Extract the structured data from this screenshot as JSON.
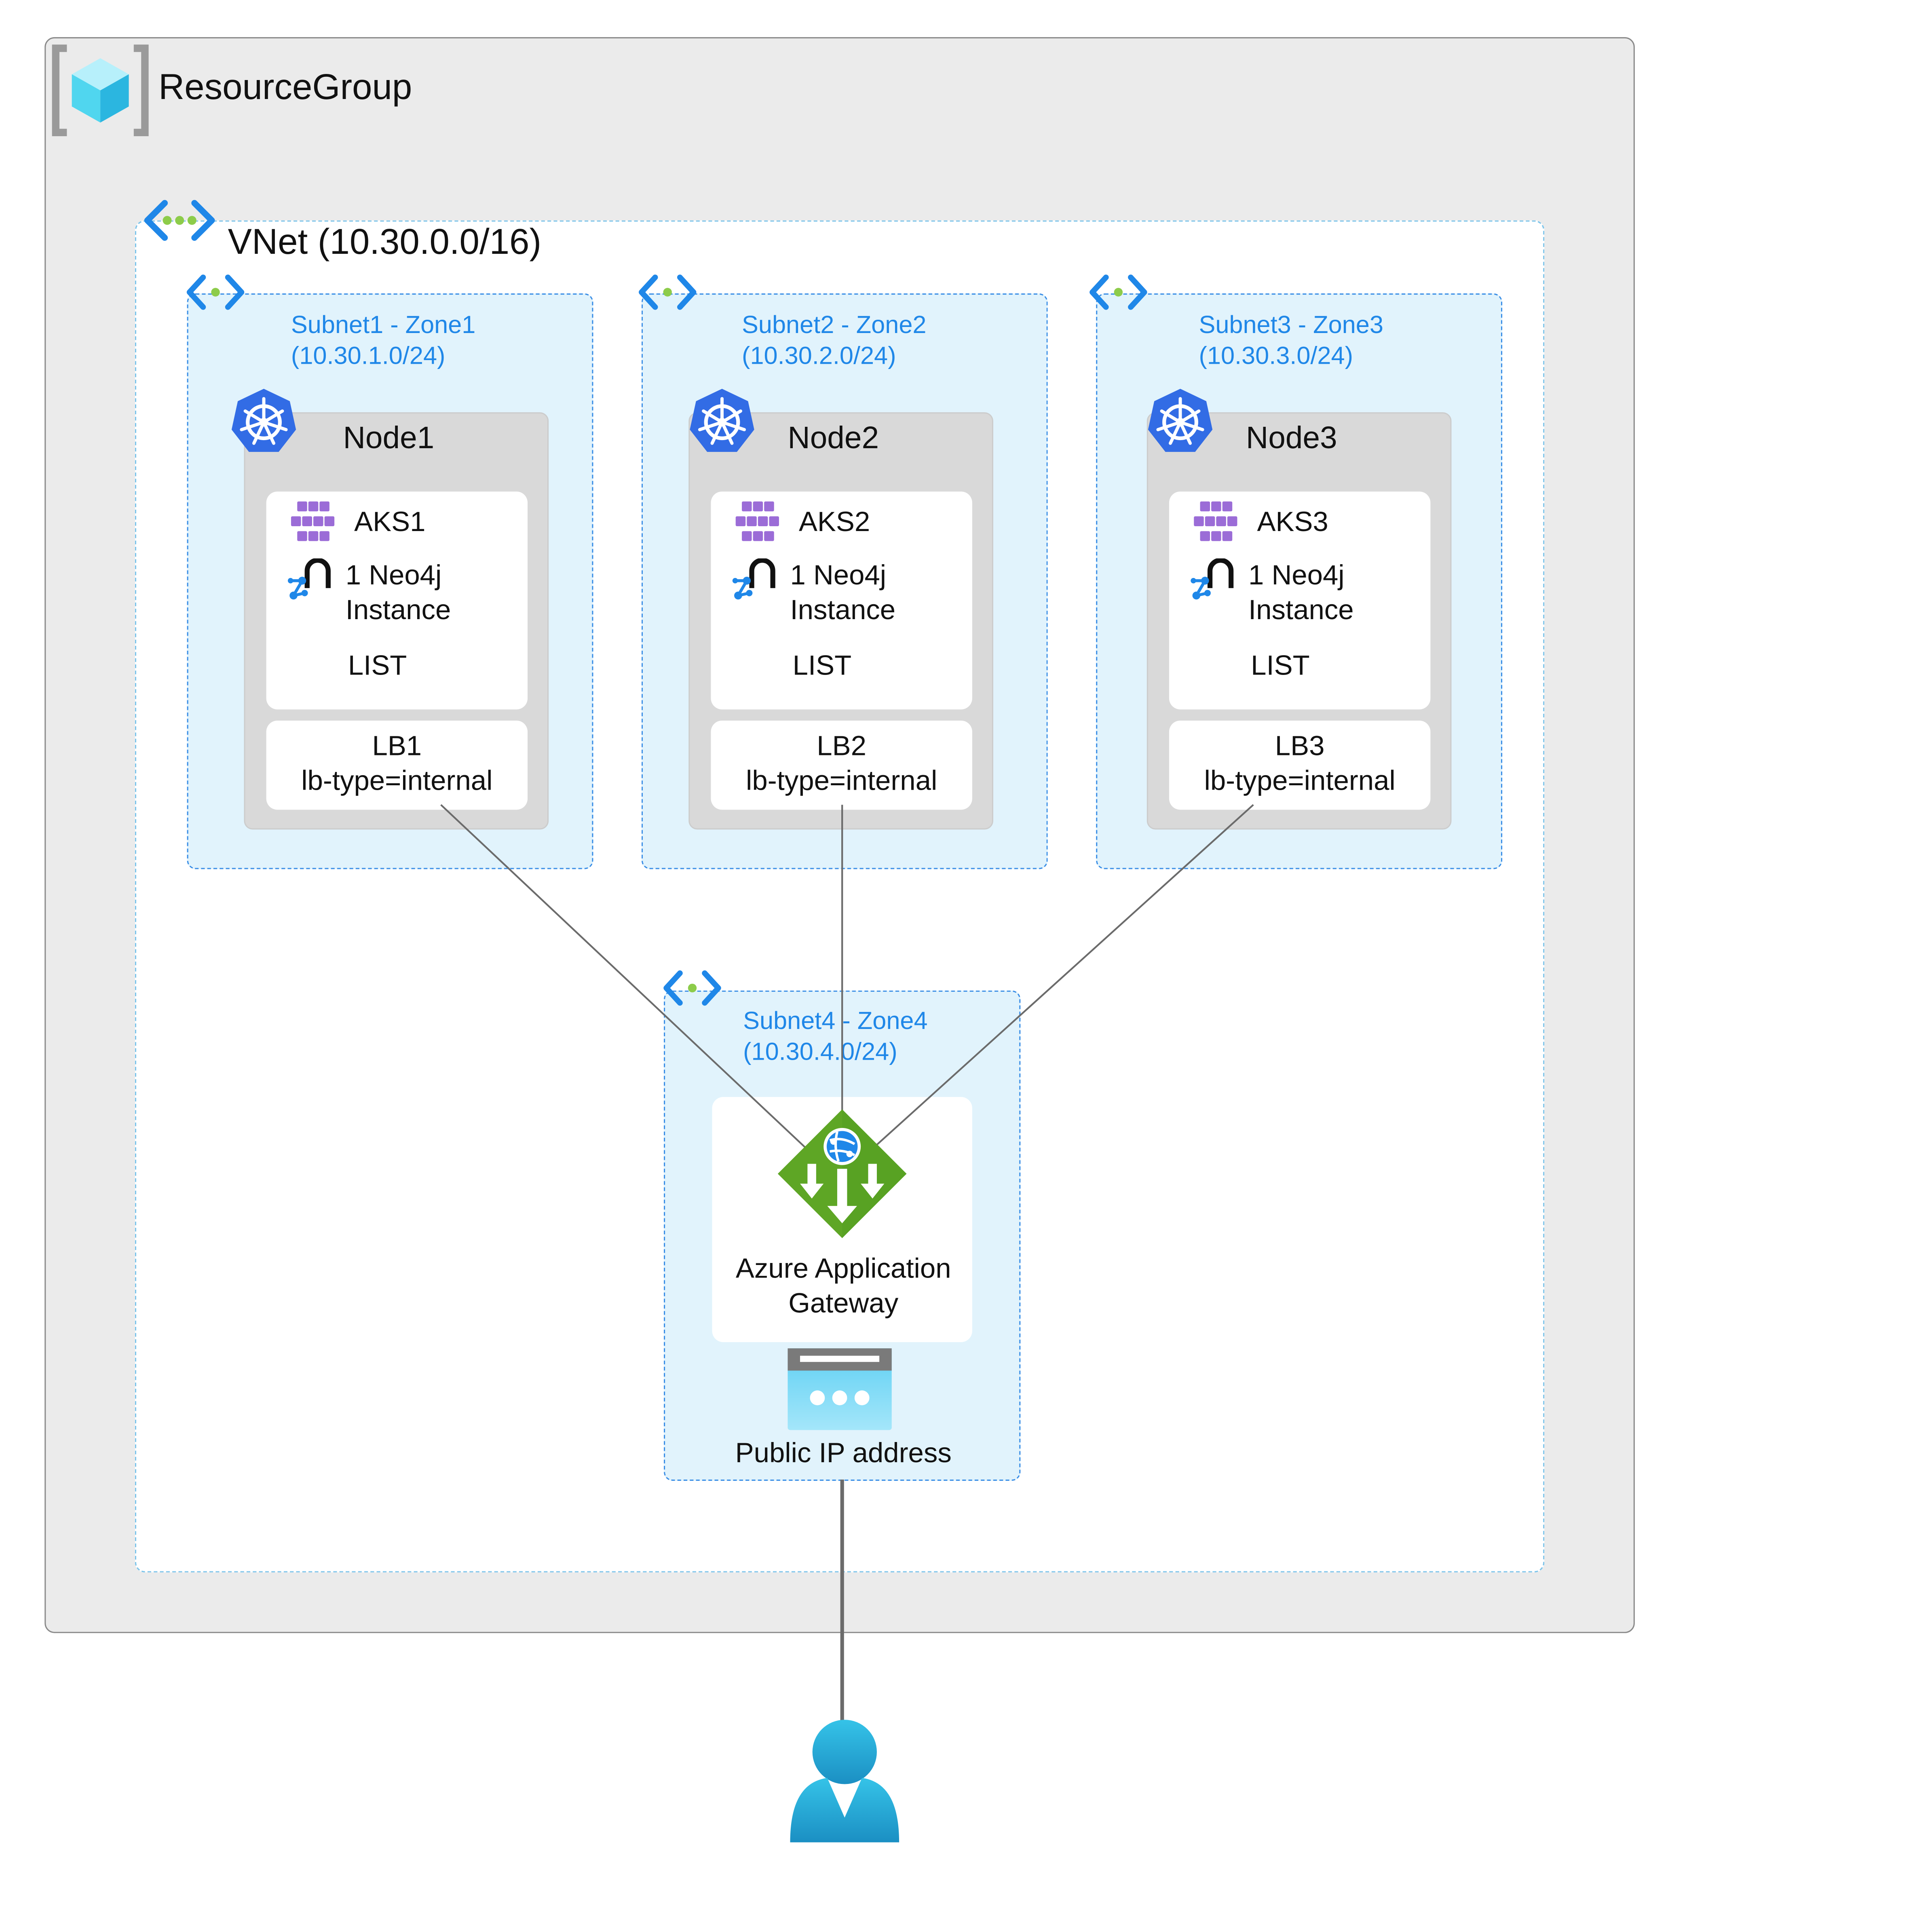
{
  "resource_group": {
    "label": "ResourceGroup",
    "icon": "resource-group-icon"
  },
  "vnet": {
    "label": "VNet (10.30.0.0/16)",
    "icon": "vnet-icon"
  },
  "subnets": [
    {
      "name": "Subnet1 - Zone1",
      "cidr": "(10.30.1.0/24)"
    },
    {
      "name": "Subnet2 - Zone2",
      "cidr": "(10.30.2.0/24)"
    },
    {
      "name": "Subnet3 - Zone3",
      "cidr": "(10.30.3.0/24)"
    },
    {
      "name": "Subnet4 - Zone4",
      "cidr": "(10.30.4.0/24)"
    }
  ],
  "nodes": [
    {
      "title": "Node1",
      "aks": "AKS1",
      "neo4j_line1": "1 Neo4j",
      "neo4j_line2": "Instance",
      "mode": "LIST",
      "lb": "LB1",
      "lb_type": "lb-type=internal"
    },
    {
      "title": "Node2",
      "aks": "AKS2",
      "neo4j_line1": "1 Neo4j",
      "neo4j_line2": "Instance",
      "mode": "LIST",
      "lb": "LB2",
      "lb_type": "lb-type=internal"
    },
    {
      "title": "Node3",
      "aks": "AKS3",
      "neo4j_line1": "1 Neo4j",
      "neo4j_line2": "Instance",
      "mode": "LIST",
      "lb": "LB3",
      "lb_type": "lb-type=internal"
    }
  ],
  "gateway": {
    "line1": "Azure Application",
    "line2": "Gateway",
    "icon": "application-gateway-icon"
  },
  "public_ip": {
    "label": "Public IP address",
    "icon": "public-ip-icon"
  },
  "user": {
    "icon": "user-icon"
  },
  "colors": {
    "resource_group_bg": "#ebebeb",
    "subnet_bg": "#e1f3fc",
    "subnet_border": "#3a8ee6",
    "subnet_text": "#1f87e8",
    "kubernetes_blue": "#326ce5",
    "gateway_green": "#5ea625",
    "aks_purple": "#9b6cd7"
  }
}
